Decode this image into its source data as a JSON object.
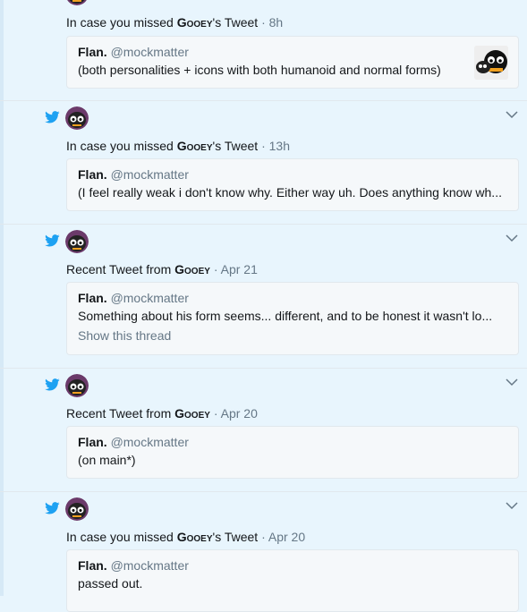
{
  "notifications": [
    {
      "context_prefix": "In case you missed ",
      "author": "Gooey",
      "context_suffix": "'s Tweet",
      "time": " · 8h",
      "card": {
        "name": "Flan.",
        "handle": "@mockmatter",
        "text": "(both personalities + icons with both humanoid and normal forms)"
      }
    },
    {
      "context_prefix": "In case you missed ",
      "author": "Gooey",
      "context_suffix": "'s Tweet",
      "time": " · 13h",
      "card": {
        "name": "Flan.",
        "handle": "@mockmatter",
        "text": "(I feel really weak i don't know why. Either way uh. Does anything know wh..."
      }
    },
    {
      "context_prefix": "Recent Tweet from ",
      "author": "Gooey",
      "context_suffix": "",
      "time": " · Apr 21",
      "card": {
        "name": "Flan.",
        "handle": "@mockmatter",
        "text": "Something about his form seems... different, and to be honest it wasn't lo...",
        "thread_link": "Show this thread"
      }
    },
    {
      "context_prefix": "Recent Tweet from ",
      "author": "Gooey",
      "context_suffix": "",
      "time": " · Apr 20",
      "card": {
        "name": "Flan.",
        "handle": "@mockmatter",
        "text": "(on main*)"
      }
    },
    {
      "context_prefix": "In case you missed ",
      "author": "Gooey",
      "context_suffix": "'s Tweet",
      "time": " · Apr 20",
      "card": {
        "name": "Flan.",
        "handle": "@mockmatter",
        "text": "passed out."
      }
    }
  ],
  "icons": {
    "bird": "twitter-bird-icon",
    "chevron": "chevron-down-icon"
  },
  "colors": {
    "twitter_blue": "#1da1f2",
    "background": "#e8f5fd",
    "card_background": "#f5f8fa",
    "secondary_text": "#657786"
  }
}
